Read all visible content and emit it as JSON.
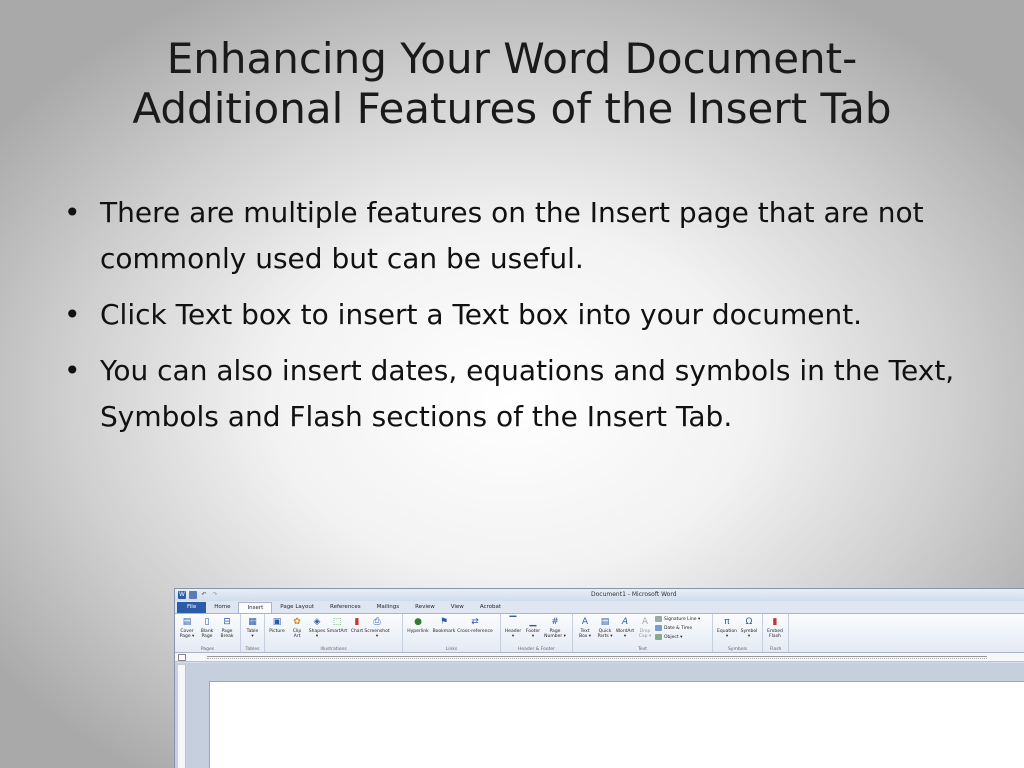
{
  "slide": {
    "title_line1": "Enhancing Your Word Document-",
    "title_line2": "Additional Features of the Insert Tab",
    "bullets": [
      "There are multiple features on the Insert page that are not commonly used but can be useful.",
      "Click Text box to insert a Text box into your document.",
      "You can also insert dates, equations and symbols in the Text, Symbols and Flash sections of the Insert Tab."
    ],
    "bullet_char": "•"
  },
  "word": {
    "window_title": "Document1 - Microsoft Word",
    "tabs": [
      "File",
      "Home",
      "Insert",
      "Page Layout",
      "References",
      "Mailings",
      "Review",
      "View",
      "Acrobat"
    ],
    "groups": {
      "pages": {
        "label": "Pages",
        "commands": [
          {
            "line1": "Cover",
            "line2": "Page ▾"
          },
          {
            "line1": "Blank",
            "line2": "Page"
          },
          {
            "line1": "Page",
            "line2": "Break"
          }
        ]
      },
      "tables": {
        "label": "Tables",
        "commands": [
          {
            "line1": "Table",
            "line2": "▾"
          }
        ]
      },
      "illustrations": {
        "label": "Illustrations",
        "commands": [
          {
            "line1": "Picture",
            "line2": ""
          },
          {
            "line1": "Clip",
            "line2": "Art"
          },
          {
            "line1": "Shapes",
            "line2": "▾"
          },
          {
            "line1": "SmartArt",
            "line2": ""
          },
          {
            "line1": "Chart",
            "line2": ""
          },
          {
            "line1": "Screenshot",
            "line2": "▾"
          }
        ]
      },
      "links": {
        "label": "Links",
        "commands": [
          {
            "line1": "Hyperlink",
            "line2": ""
          },
          {
            "line1": "Bookmark",
            "line2": ""
          },
          {
            "line1": "Cross-reference",
            "line2": ""
          }
        ]
      },
      "header_footer": {
        "label": "Header & Footer",
        "commands": [
          {
            "line1": "Header",
            "line2": "▾"
          },
          {
            "line1": "Footer",
            "line2": "▾"
          },
          {
            "line1": "Page",
            "line2": "Number ▾"
          }
        ]
      },
      "text": {
        "label": "Text",
        "commands": [
          {
            "line1": "Text",
            "line2": "Box ▾"
          },
          {
            "line1": "Quick",
            "line2": "Parts ▾"
          },
          {
            "line1": "WordArt",
            "line2": "▾"
          },
          {
            "line1": "Drop",
            "line2": "Cap ▾"
          }
        ],
        "stack": [
          "Signature Line ▾",
          "Date & Time",
          "Object ▾"
        ]
      },
      "symbols": {
        "label": "Symbols",
        "commands": [
          {
            "line1": "Equation",
            "line2": "▾"
          },
          {
            "line1": "Symbol",
            "line2": "▾"
          }
        ]
      },
      "flash": {
        "label": "Flash",
        "commands": [
          {
            "line1": "Embed",
            "line2": "Flash"
          }
        ]
      }
    }
  },
  "colors": {
    "file_tab": "#2a5caa",
    "accent_blue": "#2a5caa"
  }
}
